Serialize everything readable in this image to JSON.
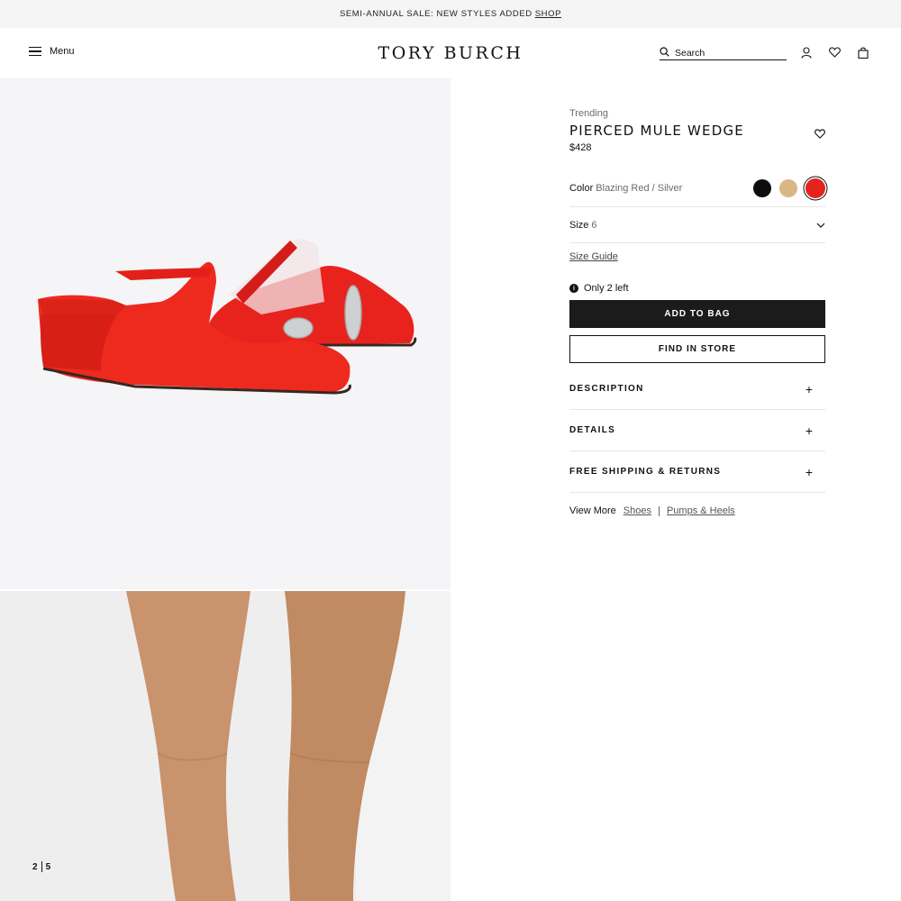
{
  "promo": {
    "text": "SEMI-ANNUAL SALE: NEW STYLES ADDED",
    "link": "SHOP"
  },
  "header": {
    "menu_label": "Menu",
    "logo": "TORY BURCH",
    "search_placeholder": "Search",
    "icons": [
      "menu-icon",
      "search-icon",
      "account-icon",
      "wishlist-icon",
      "bag-icon"
    ]
  },
  "gallery": {
    "current": "2",
    "total": "5"
  },
  "product": {
    "tag": "Trending",
    "name": "PIERCED MULE WEDGE",
    "price": "$428",
    "color_label": "Color",
    "color_value": "Blazing Red / Silver",
    "swatches": [
      {
        "color": "#0d0d0d",
        "selected": false
      },
      {
        "color": "#d9b785",
        "selected": false
      },
      {
        "color": "#e5231c",
        "selected": true
      }
    ],
    "size_label": "Size",
    "size_value": "6",
    "size_guide": "Size Guide",
    "stock_text": "Only 2 left",
    "add_to_bag": "ADD TO BAG",
    "find_in_store": "FIND IN STORE",
    "accordions": [
      "DESCRIPTION",
      "DETAILS",
      "FREE SHIPPING & RETURNS"
    ],
    "view_more_label": "View More",
    "view_more_links": [
      "Shoes",
      "Pumps & Heels"
    ]
  }
}
